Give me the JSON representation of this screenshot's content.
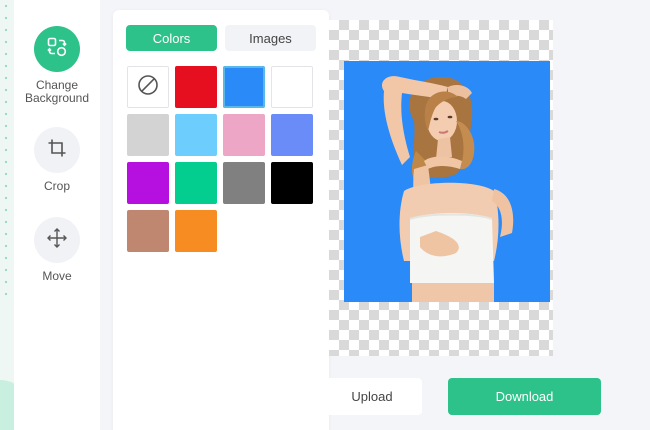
{
  "sidebar": {
    "tools": [
      {
        "label": "Change Background",
        "icon": "change-background-icon"
      },
      {
        "label": "Crop",
        "icon": "crop-icon"
      },
      {
        "label": "Move",
        "icon": "move-icon"
      }
    ]
  },
  "panel": {
    "tabs": [
      {
        "label": "Colors",
        "active": true
      },
      {
        "label": "Images",
        "active": false
      }
    ],
    "swatches": [
      {
        "name": "none",
        "color": "none"
      },
      {
        "name": "red",
        "color": "#e50f20"
      },
      {
        "name": "blue",
        "color": "#2a8af8",
        "selected": true
      },
      {
        "name": "white",
        "color": "#ffffff"
      },
      {
        "name": "light-gray",
        "color": "#d3d3d3"
      },
      {
        "name": "sky-blue",
        "color": "#6dcdfd"
      },
      {
        "name": "pink",
        "color": "#eda6c6"
      },
      {
        "name": "periwinkle",
        "color": "#6a8cf9"
      },
      {
        "name": "purple",
        "color": "#b610e0"
      },
      {
        "name": "green",
        "color": "#03cd8f"
      },
      {
        "name": "gray",
        "color": "#808080"
      },
      {
        "name": "black",
        "color": "#000000"
      },
      {
        "name": "brown",
        "color": "#bf8770"
      },
      {
        "name": "orange",
        "color": "#f78c22"
      }
    ]
  },
  "canvas": {
    "background_color": "#2a8af8"
  },
  "actions": {
    "upload_label": "Upload",
    "download_label": "Download"
  },
  "colors": {
    "accent": "#2ec28b"
  }
}
